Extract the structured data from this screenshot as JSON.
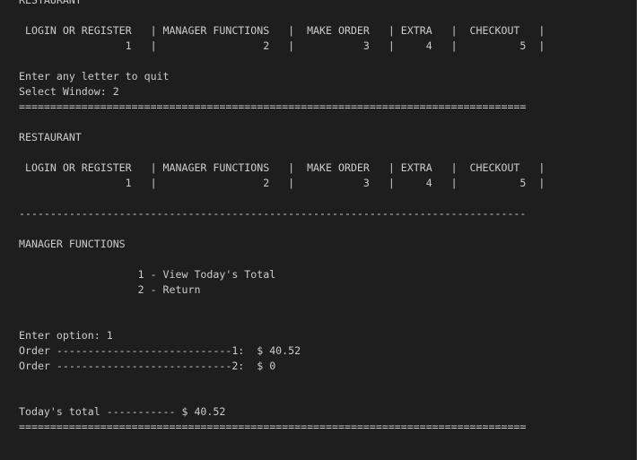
{
  "terminal": {
    "lines": [
      "",
      "RESTAURANT",
      "",
      " LOGIN OR REGISTER   | MANAGER FUNCTIONS   |  MAKE ORDER   | EXTRA   |  CHECKOUT   |",
      "                 1   |                 2   |           3   |     4   |          5  |",
      "",
      "Enter any letter to quit",
      "Select Window: 2",
      "=================================================================================",
      "",
      "RESTAURANT",
      "",
      " LOGIN OR REGISTER   | MANAGER FUNCTIONS   |  MAKE ORDER   | EXTRA   |  CHECKOUT   |",
      "                 1   |                 2   |           3   |     4   |          5  |",
      "",
      "---------------------------------------------------------------------------------",
      "",
      "MANAGER FUNCTIONS",
      "",
      "                   1 - View Today's Total",
      "                   2 - Return",
      "",
      "",
      "Enter option: 1",
      "Order ----------------------------1:  $ 40.52",
      "Order ----------------------------2:  $ 0",
      "",
      "",
      "Today's total ----------- $ 40.52",
      "================================================================================="
    ]
  }
}
